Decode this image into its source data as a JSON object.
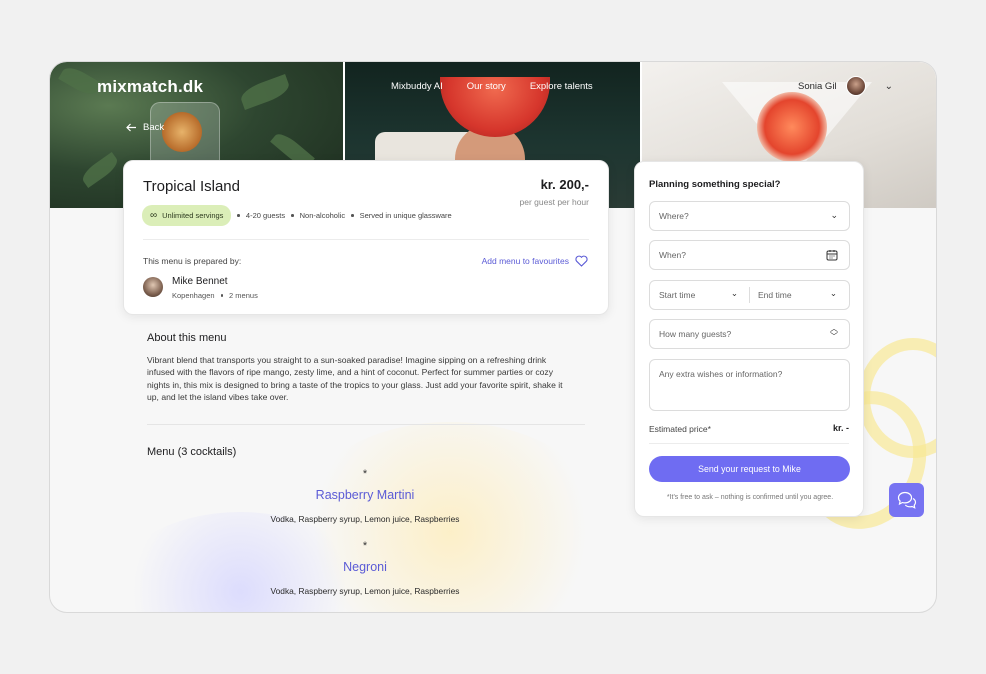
{
  "header": {
    "logo": "mixmatch.dk",
    "nav": [
      "Mixbuddy AI",
      "Our story",
      "Explore talents"
    ],
    "user_name": "Sonia Gil",
    "back_label": "Back"
  },
  "menu": {
    "title": "Tropical Island",
    "price": "kr. 200,-",
    "price_unit": "per guest per hour",
    "pill": "Unlimited servings",
    "tags": [
      "4-20 guests",
      "Non-alcoholic",
      "Served in unique glassware"
    ],
    "prepared_by_label": "This menu is prepared by:",
    "favourite_label": "Add menu to favourites",
    "chef_name": "Mike Bennet",
    "chef_city": "Kopenhagen",
    "chef_menus": "2 menus"
  },
  "about": {
    "heading": "About this menu",
    "text": "Vibrant blend that transports you straight to a sun-soaked paradise! Imagine sipping on a refreshing drink infused with the flavors of ripe mango, zesty lime, and a hint of coconut. Perfect for summer parties or cozy nights in, this mix is designed to bring a taste of the tropics to your glass. Just add your favorite spirit, shake it up, and let the island vibes take over."
  },
  "cocktails": {
    "heading": "Menu (3 cocktails)",
    "star": "*",
    "items": [
      {
        "name": "Raspberry Martini",
        "ingredients": "Vodka, Raspberry syrup, Lemon juice, Raspberries"
      },
      {
        "name": "Negroni",
        "ingredients": "Vodka, Raspberry syrup, Lemon juice, Raspberries"
      }
    ]
  },
  "form": {
    "heading": "Planning something special?",
    "where": "Where?",
    "when": "When?",
    "start_time": "Start time",
    "end_time": "End time",
    "guests": "How many guests?",
    "wishes_placeholder": "Any extra wishes or information?",
    "estimate_label": "Estimated price*",
    "estimate_value": "kr. -",
    "send_label": "Send your request to Mike",
    "note": "*It's free to ask – nothing is confirmed until you agree."
  },
  "colors": {
    "accent": "#6f6cf2",
    "pill": "#dbeeb8",
    "link": "#5b5bd6"
  }
}
